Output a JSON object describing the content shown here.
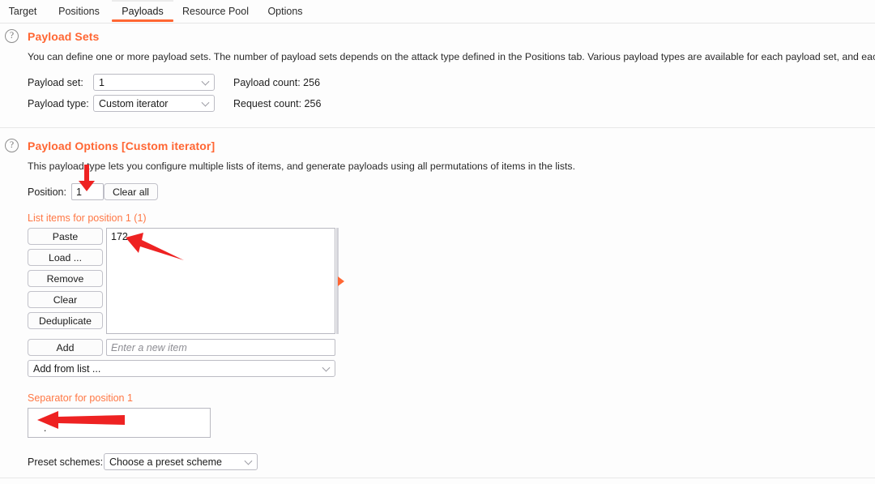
{
  "tabs": [
    {
      "label": "Target",
      "active": false
    },
    {
      "label": "Positions",
      "active": false
    },
    {
      "label": "Payloads",
      "active": true
    },
    {
      "label": "Resource Pool",
      "active": false
    },
    {
      "label": "Options",
      "active": false
    }
  ],
  "help_glyph": "?",
  "payload_sets": {
    "title": "Payload Sets",
    "description": "You can define one or more payload sets. The number of payload sets depends on the attack type defined in the Positions tab. Various payload types are available for each payload set, and eac",
    "payload_set_label": "Payload set:",
    "payload_set_value": "1",
    "payload_type_label": "Payload type:",
    "payload_type_value": "Custom iterator",
    "payload_count_label": "Payload count: 256",
    "request_count_label": "Request count: 256"
  },
  "payload_options": {
    "title": "Payload Options [Custom iterator]",
    "description": "This payload type lets you configure multiple lists of items, and generate payloads using all permutations of items in the lists.",
    "position_label": "Position:",
    "position_value": "1",
    "clear_all_label": "Clear all",
    "list_items_heading": "List items for position 1 (1)",
    "list_buttons": [
      "Paste",
      "Load ...",
      "Remove",
      "Clear",
      "Deduplicate"
    ],
    "list_items": [
      "172"
    ],
    "add_button_label": "Add",
    "add_input_placeholder": "Enter a new item",
    "add_from_list_label": "Add from list ...",
    "separator_heading": "Separator for position 1",
    "separator_value": ".",
    "preset_schemes_label": "Preset schemes:",
    "preset_schemes_value": "Choose a preset scheme"
  },
  "colors": {
    "accent": "#ff6633",
    "accent_light": "#ff7744",
    "annotation": "#ee2222",
    "background": "#fdfdfd",
    "border": "#bcbcc4"
  }
}
